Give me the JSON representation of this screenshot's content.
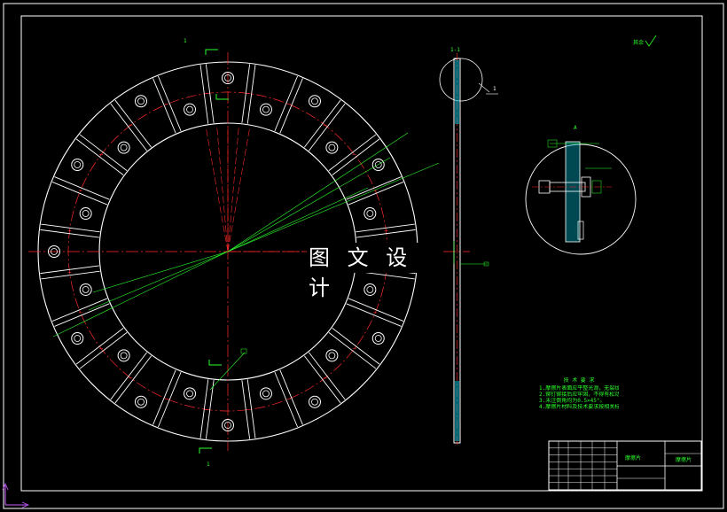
{
  "watermark": "图 文 设 计",
  "colors": {
    "background": "#000000",
    "outline": "#ffffff",
    "centerline": "#ff2a2a",
    "dimension": "#2cff2c",
    "hatch": "#00e5e5"
  },
  "labels": {
    "section_mark_top": "1",
    "section_mark_bottom": "1",
    "section_view_title": "1-1",
    "detail_callout": "1",
    "detail_view_title": "A",
    "roughness_note": "其余"
  },
  "tech_requirements": {
    "title": "技 术 要 求",
    "lines": [
      "1.摩擦片表面应平整光滑，无裂纹。",
      "2.铆钉铆接后应牢固，不得有松动现象。",
      "3.未注倒角均为0.5×45°。",
      "4.摩擦片材料及技术要求按相关标准。"
    ]
  },
  "title_block": {
    "part_name": "摩擦片",
    "drawing_number": "摩擦片"
  },
  "icons": [
    "ucs-axis-icon",
    "roughness-symbol-icon"
  ]
}
